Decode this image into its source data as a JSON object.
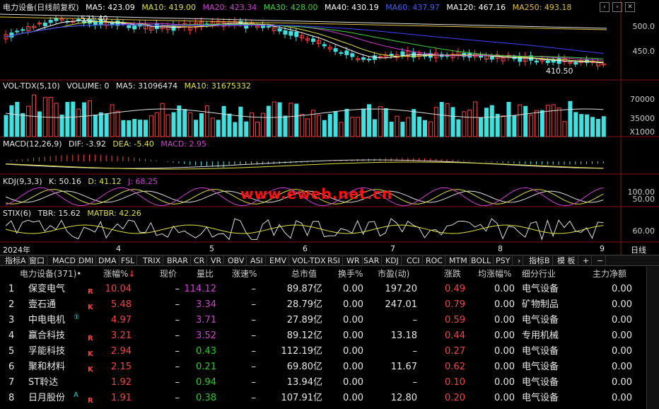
{
  "kline": {
    "title": "电力设备(日线前复权)",
    "ma5": "MA5: 423.09",
    "ma10": "MA10: 419.00",
    "ma20": "MA20: 423.34",
    "ma30": "MA30: 428.00",
    "ma40": "MA40: 430.19",
    "ma60": "MA60: 437.97",
    "ma120": "MA120: 467.16",
    "ma250": "MA250: 493.18",
    "high_label": "521.40",
    "low_label": "410.50",
    "axis": [
      "500.0",
      "450.0"
    ]
  },
  "volume": {
    "title": "VOL-TDX(5,10)",
    "volume": "VOLUME: 0",
    "ma5": "MA5: 31096474",
    "ma10": "MA10: 31675332",
    "axis": [
      "70000",
      "35000",
      "X1000"
    ]
  },
  "macd": {
    "title": "MACD(12,26,9)",
    "dif": "DIF: -3.92",
    "dea": "DEA: -5.40",
    "macd": "MACD: 2.95"
  },
  "kdj": {
    "title": "KDJ(9,3,3)",
    "k": "K: 50.16",
    "d": "D: 41.12",
    "j": "J: 68.25",
    "axis": [
      "100.00",
      "50.00"
    ]
  },
  "stix": {
    "title": "STIX(6)",
    "tbr": "TBR: 15.62",
    "matbr": "MATBR: 42.26",
    "axis": [
      "60.00"
    ]
  },
  "watermark": "www.eweb.net.cn",
  "timeaxis": {
    "year": "2024年",
    "months": [
      "4",
      "5",
      "6",
      "7",
      "8",
      "9"
    ],
    "period": "日线"
  },
  "tabs": [
    "指标A",
    "窗口",
    "MACD",
    "DMI",
    "DMA",
    "FSL",
    "TRIX",
    "BRAR",
    "CR",
    "VR",
    "OBV",
    "ASI",
    "EMV",
    "VOL-TDX",
    "RSI",
    "WR",
    "SAR",
    "KDJ",
    "CCI",
    "ROC",
    "MTM",
    "BOLL",
    "PSY",
    "›",
    "指标B",
    "模 板",
    "+",
    "−"
  ],
  "table": {
    "headers": {
      "name": "电力设备(371)•",
      "change_pct": "涨幅%",
      "sort_icon": "↓",
      "price": "现价",
      "vol_ratio": "量比",
      "speed": "涨速%",
      "mktcap": "总市值",
      "turnover": "换手%",
      "pe": "市盈(动)",
      "change": "涨跌",
      "avg_change": "均涨幅%",
      "industry": "细分行业",
      "netflow": "主力净额"
    },
    "rows": [
      {
        "idx": "1",
        "name": "保变电气",
        "mark": "",
        "tag": "R",
        "change_pct": "10.04",
        "price": "–",
        "vol_ratio": "114.12",
        "vr_color": "purple",
        "speed": "–",
        "mktcap": "89.87亿",
        "turnover": "0.00",
        "pe": "197.20",
        "change": "0.49",
        "avg_change": "0.00",
        "industry": "电气设备",
        "netflow": "0.00"
      },
      {
        "idx": "2",
        "name": "壹石通",
        "mark": "",
        "tag": "K",
        "change_pct": "5.48",
        "price": "–",
        "vol_ratio": "3.34",
        "vr_color": "purple",
        "speed": "–",
        "mktcap": "28.79亿",
        "turnover": "0.00",
        "pe": "247.01",
        "change": "0.79",
        "avg_change": "0.00",
        "industry": "矿物制品",
        "netflow": "0.00"
      },
      {
        "idx": "3",
        "name": "中电电机",
        "mark": "①",
        "tag": "",
        "change_pct": "4.97",
        "price": "–",
        "vol_ratio": "3.71",
        "vr_color": "purple",
        "speed": "–",
        "mktcap": "27.89亿",
        "turnover": "0.00",
        "pe": "–",
        "change": "0.59",
        "avg_change": "0.00",
        "industry": "电气设备",
        "netflow": "0.00"
      },
      {
        "idx": "4",
        "name": "赢合科技",
        "mark": "",
        "tag": "R",
        "change_pct": "3.21",
        "price": "–",
        "vol_ratio": "3.52",
        "vr_color": "purple",
        "speed": "–",
        "mktcap": "89.12亿",
        "turnover": "0.00",
        "pe": "13.18",
        "change": "0.44",
        "avg_change": "0.00",
        "industry": "专用机械",
        "netflow": "0.00"
      },
      {
        "idx": "5",
        "name": "孚能科技",
        "mark": "",
        "tag": "K",
        "change_pct": "2.94",
        "price": "–",
        "vol_ratio": "0.43",
        "vr_color": "green",
        "speed": "–",
        "mktcap": "112.19亿",
        "turnover": "0.00",
        "pe": "–",
        "change": "0.27",
        "avg_change": "0.00",
        "industry": "电气设备",
        "netflow": "0.00"
      },
      {
        "idx": "6",
        "name": "聚和材料",
        "mark": "",
        "tag": "K",
        "change_pct": "2.15",
        "price": "–",
        "vol_ratio": "0.21",
        "vr_color": "green",
        "speed": "–",
        "mktcap": "69.80亿",
        "turnover": "0.00",
        "pe": "11.67",
        "change": "0.62",
        "avg_change": "0.00",
        "industry": "电气设备",
        "netflow": "0.00"
      },
      {
        "idx": "7",
        "name": "ST聆达",
        "mark": "",
        "tag": "",
        "change_pct": "1.92",
        "price": "–",
        "vol_ratio": "0.94",
        "vr_color": "green",
        "speed": "–",
        "mktcap": "13.94亿",
        "turnover": "0.00",
        "pe": "–",
        "change": "0.10",
        "avg_change": "0.00",
        "industry": "电气设备",
        "netflow": "0.00"
      },
      {
        "idx": "8",
        "name": "日月股份",
        "mark": "A",
        "tag": "R",
        "change_pct": "1.91",
        "price": "–",
        "vol_ratio": "0.38",
        "vr_color": "green",
        "speed": "–",
        "mktcap": "107.91亿",
        "turnover": "0.00",
        "pe": "12.80",
        "change": "0.20",
        "avg_change": "0.00",
        "industry": "电气设备",
        "netflow": "0.00"
      }
    ]
  },
  "colors": {
    "up": "#ff4040",
    "down": "#40e0e0",
    "ma5": "#ffffff",
    "ma10": "#e0e040",
    "ma20": "#d040d0",
    "ma30": "#40d040",
    "ma60": "#4040ff",
    "ma120": "#e0e0e0",
    "ma250": "#e0c040"
  }
}
